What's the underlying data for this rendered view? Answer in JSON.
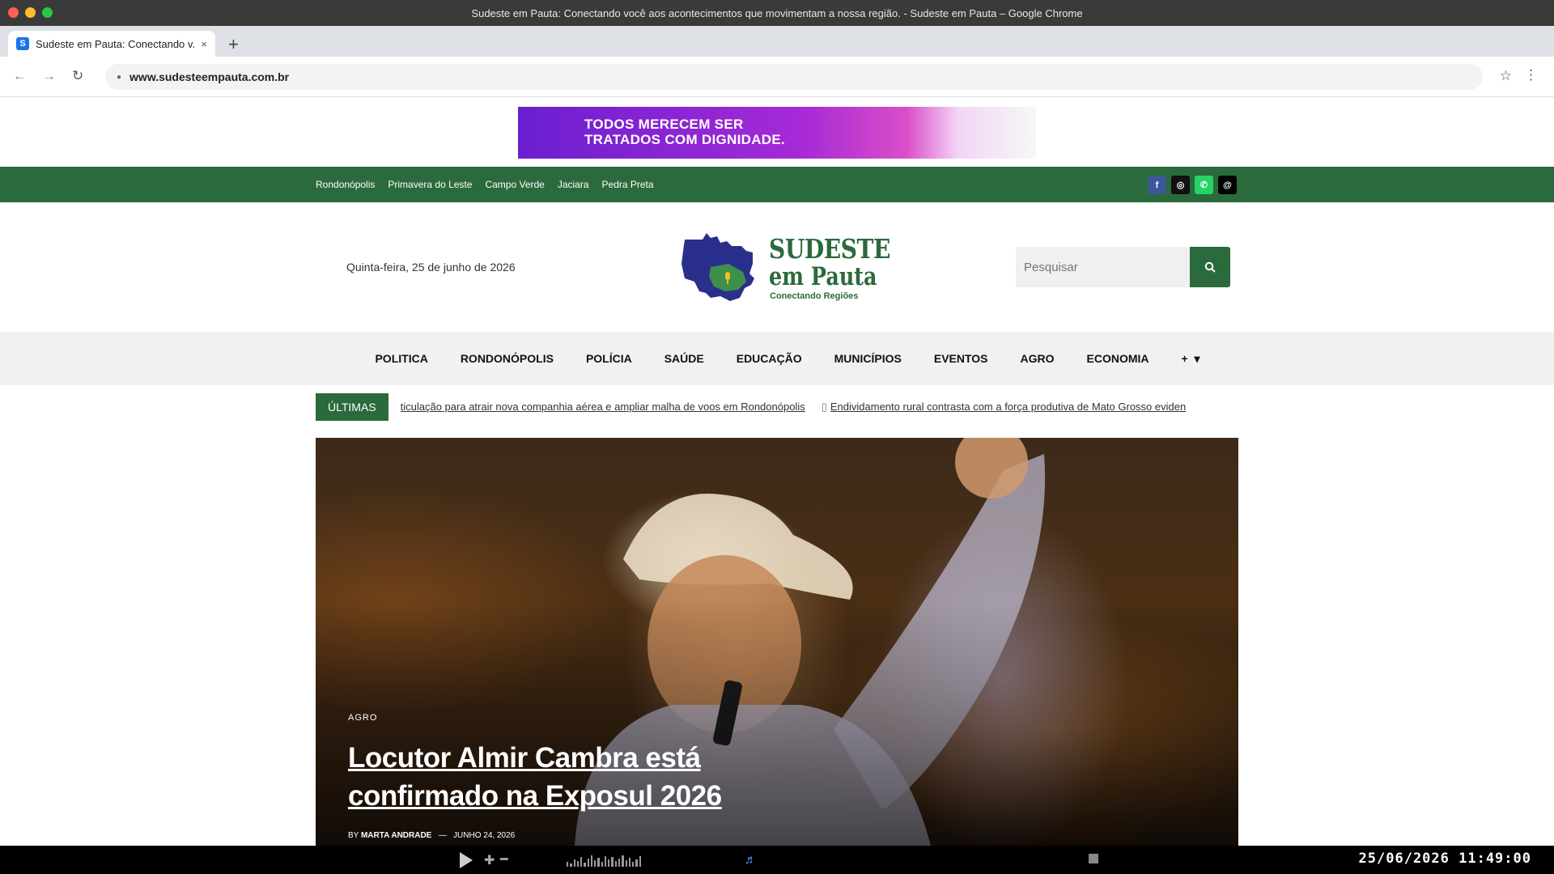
{
  "window": {
    "title": "Sudeste em Pauta: Conectando você aos acontecimentos que movimentam a nossa região. - Sudeste em Pauta – Google Chrome"
  },
  "tab": {
    "favicon_letter": "S",
    "label": "Sudeste em Pauta: Conectando v...",
    "close": "×",
    "new_tab": "+"
  },
  "toolbar": {
    "back": "←",
    "forward": "→",
    "reload": "↻",
    "url": "www.sudesteempauta.com.br",
    "star": "☆",
    "menu": "⋮"
  },
  "ad": {
    "line1": "TODOS MERECEM SER",
    "line2": "TRATADOS COM DIGNIDADE."
  },
  "top_bar": {
    "cities": [
      "Rondonópolis",
      "Primavera do Leste",
      "Campo Verde",
      "Jaciara",
      "Pedra Preta"
    ],
    "socials": [
      {
        "name": "facebook-icon",
        "glyph": "f",
        "color": "#3b5998"
      },
      {
        "name": "instagram-icon",
        "glyph": "◎",
        "color": "#111111"
      },
      {
        "name": "whatsapp-icon",
        "glyph": "✆",
        "color": "#25d366"
      },
      {
        "name": "threads-icon",
        "glyph": "@",
        "color": "#000000"
      }
    ]
  },
  "header": {
    "date": "Quinta-feira, 25 de junho de 2026",
    "logo_line1": "SUDESTE",
    "logo_line2": "em Pauta",
    "logo_tagline": "Conectando Regiões",
    "search_placeholder": "Pesquisar"
  },
  "nav": {
    "items": [
      "POLITICA",
      "RONDONÓPOLIS",
      "POLÍCIA",
      "SAÚDE",
      "EDUCAÇÃO",
      "MUNICÍPIOS",
      "EVENTOS",
      "AGRO",
      "ECONOMIA"
    ],
    "more": "+"
  },
  "ticker": {
    "label": "ÚLTIMAS",
    "items": [
      "ticulação para atrair nova companhia aérea e ampliar malha de voos em Rondonópolis",
      "Endividamento rural contrasta com a força produtiva de Mato Grosso eviden"
    ]
  },
  "hero": {
    "category": "AGRO",
    "headline": "Locutor Almir Cambra está confirmado na Exposul 2026",
    "by": "BY",
    "author": "MARTA ANDRADE",
    "dash": "—",
    "date": "JUNHO 24, 2026"
  },
  "taskbar": {
    "clock": "25/06/2026 11:49:00"
  },
  "colors": {
    "brand_green": "#2b6a3c",
    "logo_blue": "#2a2f8c"
  }
}
